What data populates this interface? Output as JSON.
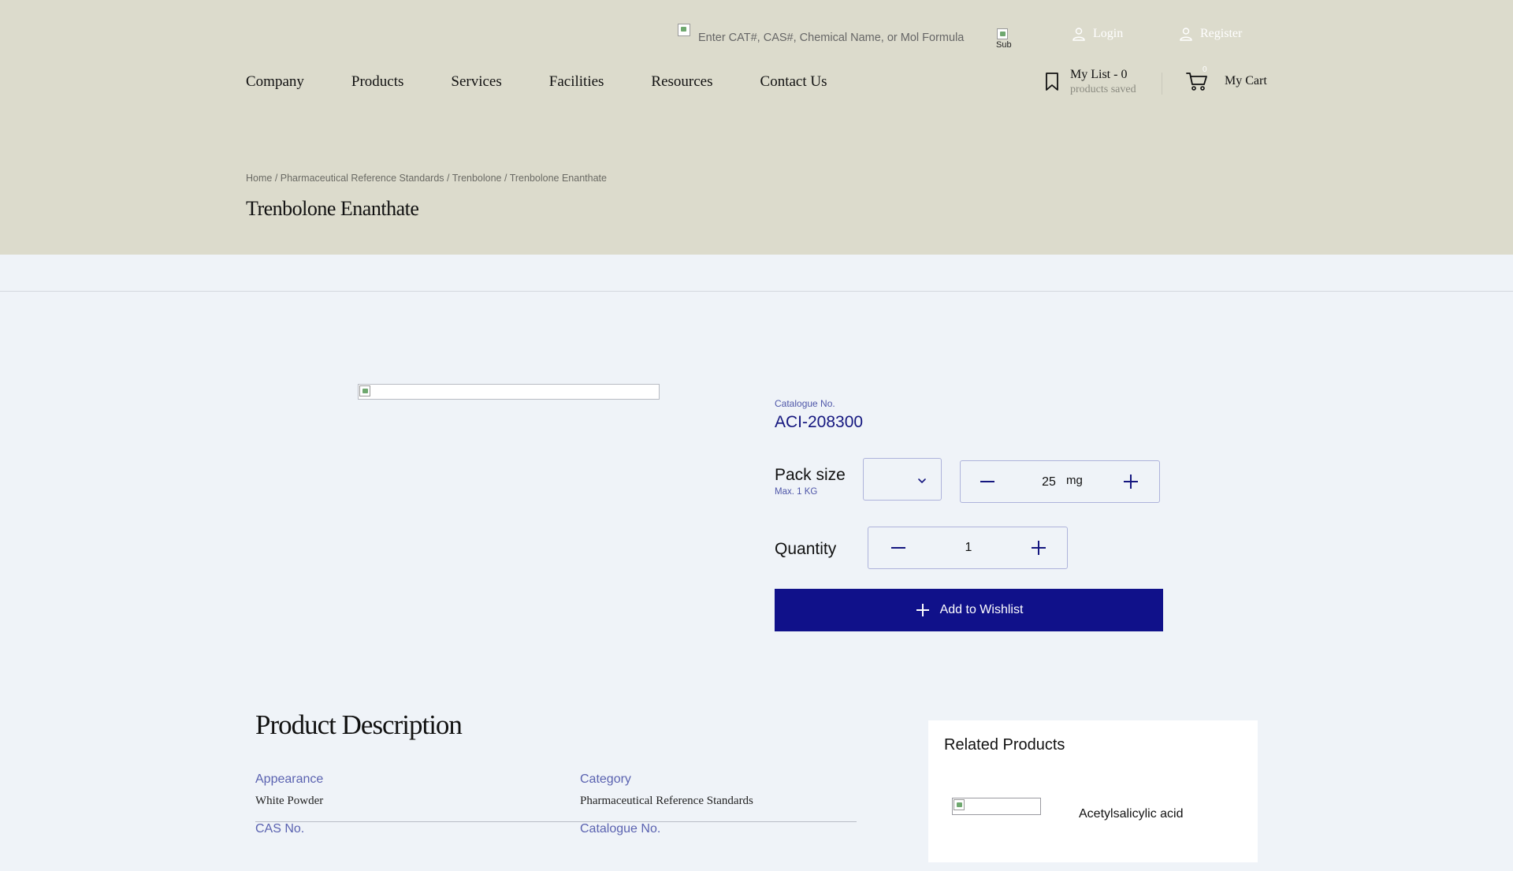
{
  "header": {
    "search": {
      "placeholder": "Enter CAT#, CAS#, Chemical Name, or Mol Formula",
      "submit_alt": "Sub"
    },
    "auth": {
      "login": "Login",
      "register": "Register"
    },
    "nav": [
      "Company",
      "Products",
      "Services",
      "Facilities",
      "Resources",
      "Contact Us"
    ],
    "mylist": {
      "title": "My List - 0",
      "subtitle": "products saved"
    },
    "cart": {
      "count": "0",
      "label": "My Cart"
    },
    "breadcrumb": [
      "Home",
      "Pharmaceutical Reference Standards",
      "Trenbolone",
      "Trenbolone Enanthate"
    ],
    "title": "Trenbolone Enanthate"
  },
  "product": {
    "catalogue_label": "Catalogue No.",
    "catalogue_no": "ACI-208300",
    "pack_size_label": "Pack size",
    "pack_size_max": "Max. 1 KG",
    "size_value": "25",
    "size_unit": "mg",
    "quantity_label": "Quantity",
    "quantity_value": "1",
    "wishlist_label": "Add to Wishlist"
  },
  "description": {
    "title": "Product Description",
    "rows": [
      [
        {
          "label": "Appearance",
          "value": "White Powder"
        },
        {
          "label": "Category",
          "value": "Pharmaceutical Reference Standards"
        }
      ],
      [
        {
          "label": "CAS No.",
          "value": ""
        },
        {
          "label": "Catalogue No.",
          "value": ""
        }
      ]
    ]
  },
  "related": {
    "title": "Related Products",
    "items": [
      {
        "name": "Acetylsalicylic acid"
      }
    ]
  },
  "colors": {
    "header_bg": "#dcdbcc",
    "page_bg": "#eff3f8",
    "primary": "#10118a",
    "label": "#5a62b0"
  }
}
